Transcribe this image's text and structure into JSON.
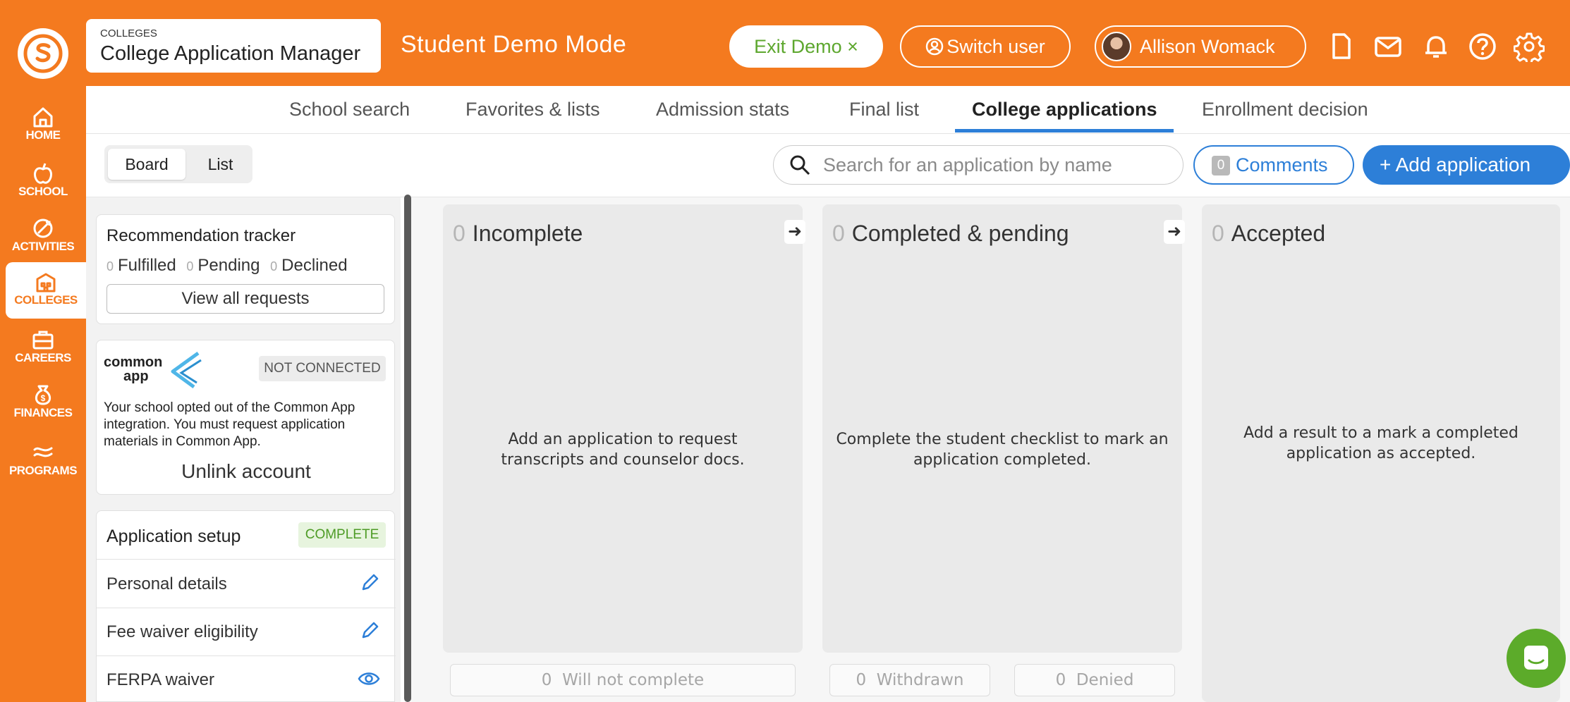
{
  "sidebar": {
    "items": [
      {
        "label": "HOME",
        "icon": "home-icon"
      },
      {
        "label": "SCHOOL",
        "icon": "apple-icon"
      },
      {
        "label": "ACTIVITIES",
        "icon": "activities-icon"
      },
      {
        "label": "COLLEGES",
        "icon": "college-building-icon",
        "active": true
      },
      {
        "label": "CAREERS",
        "icon": "briefcase-icon"
      },
      {
        "label": "FINANCES",
        "icon": "money-bag-icon"
      },
      {
        "label": "PROGRAMS",
        "icon": "programs-icon"
      }
    ]
  },
  "header": {
    "module_caption": "COLLEGES",
    "module_title": "College Application Manager",
    "demo_mode": "Student Demo Mode",
    "exit_demo": "Exit Demo ×",
    "switch_user": "Switch user",
    "user_name": "Allison Womack"
  },
  "tabs": [
    {
      "label": "School search"
    },
    {
      "label": "Favorites & lists"
    },
    {
      "label": "Admission stats"
    },
    {
      "label": "Final list"
    },
    {
      "label": "College applications",
      "active": true
    },
    {
      "label": "Enrollment decision"
    }
  ],
  "toolbar": {
    "view_board": "Board",
    "view_list": "List",
    "search_placeholder": "Search for an application by name",
    "comments_count": "0",
    "comments_label": "Comments",
    "add_application": "+ Add application"
  },
  "recommendation_tracker": {
    "title": "Recommendation tracker",
    "fulfilled_count": "0",
    "fulfilled_label": "Fulfilled",
    "pending_count": "0",
    "pending_label": "Pending",
    "declined_count": "0",
    "declined_label": "Declined",
    "view_all": "View all requests"
  },
  "common_app": {
    "logo_text_1": "common",
    "logo_text_2": "app",
    "status": "NOT CONNECTED",
    "message": "Your school opted out of the Common App integration. You must request application materials in Common App.",
    "unlink": "Unlink account"
  },
  "application_setup": {
    "title": "Application setup",
    "status": "COMPLETE",
    "items": [
      {
        "label": "Personal details",
        "icon": "pencil-icon"
      },
      {
        "label": "Fee waiver eligibility",
        "icon": "pencil-icon"
      },
      {
        "label": "FERPA waiver",
        "icon": "eye-icon"
      }
    ]
  },
  "board": {
    "columns": [
      {
        "count": "0",
        "title": "Incomplete",
        "message": "Add an application to request transcripts and counselor docs."
      },
      {
        "count": "0",
        "title": "Completed & pending",
        "message": "Complete the student checklist to mark an application completed."
      },
      {
        "count": "0",
        "title": "Accepted",
        "message": "Add a result to a mark a completed application as accepted."
      }
    ],
    "will_not_complete": {
      "count": "0",
      "label": "Will not complete"
    },
    "withdrawn": {
      "count": "0",
      "label": "Withdrawn"
    },
    "denied": {
      "count": "0",
      "label": "Denied"
    }
  },
  "colors": {
    "brand_orange": "#f47a1f",
    "primary_blue": "#2d7fd8",
    "success_green": "#5da72e",
    "chat_green": "#5cab2a"
  }
}
